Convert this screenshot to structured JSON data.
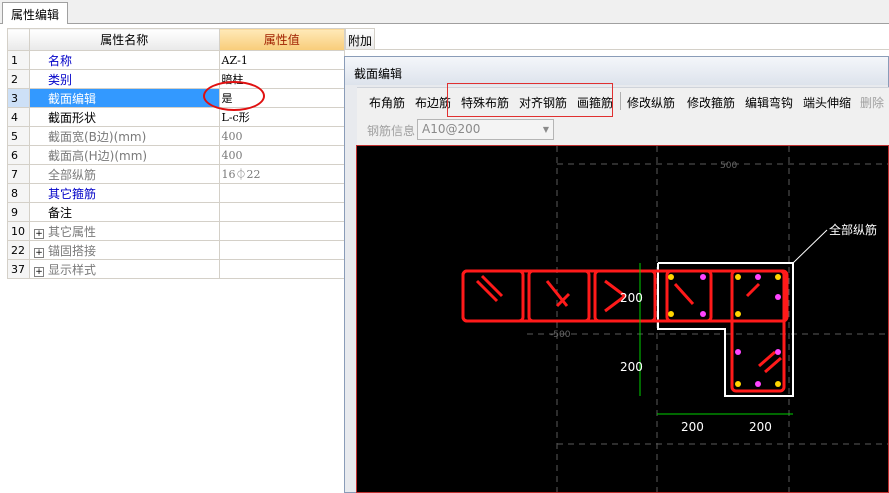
{
  "tab": {
    "label": "属性编辑"
  },
  "grid": {
    "header": {
      "name": "属性名称",
      "value": "属性值"
    },
    "rows": [
      {
        "num": "1",
        "name": "名称",
        "value": "AZ-1"
      },
      {
        "num": "2",
        "name": "类别",
        "value": "暗柱"
      },
      {
        "num": "3",
        "name": "截面编辑",
        "value": "是"
      },
      {
        "num": "4",
        "name": "截面形状",
        "value": "L-c形"
      },
      {
        "num": "5",
        "name": "截面宽(B边)(mm)",
        "value": "400"
      },
      {
        "num": "6",
        "name": "截面高(H边)(mm)",
        "value": "400"
      },
      {
        "num": "7",
        "name": "全部纵筋",
        "value": "16⏀22"
      },
      {
        "num": "8",
        "name": "其它箍筋",
        "value": ""
      },
      {
        "num": "9",
        "name": "备注",
        "value": ""
      },
      {
        "num": "10",
        "name": "其它属性",
        "value": ""
      },
      {
        "num": "22",
        "name": "锚固搭接",
        "value": ""
      },
      {
        "num": "37",
        "name": "显示样式",
        "value": ""
      }
    ]
  },
  "extra_column": {
    "label": "附加"
  },
  "dialog": {
    "title": "截面编辑",
    "toolbar": [
      "布角筋",
      "布边筋",
      "特殊布筋",
      "对齐钢筋",
      "画箍筋",
      "修改纵筋",
      "修改箍筋",
      "编辑弯钩",
      "端头伸缩",
      "删除"
    ],
    "rebar_info_label": "钢筋信息",
    "rebar_info_value": "A10@200"
  },
  "canvas": {
    "label_all_rebar": "全部纵筋",
    "dims": [
      "200",
      "200",
      "200",
      "200"
    ],
    "axis_500_top": "500",
    "axis_500_left": "-500"
  },
  "colors": {
    "annotation_red": "#e01010",
    "selected_row": "#3399ff",
    "rebar_red": "#ff1a1a"
  }
}
